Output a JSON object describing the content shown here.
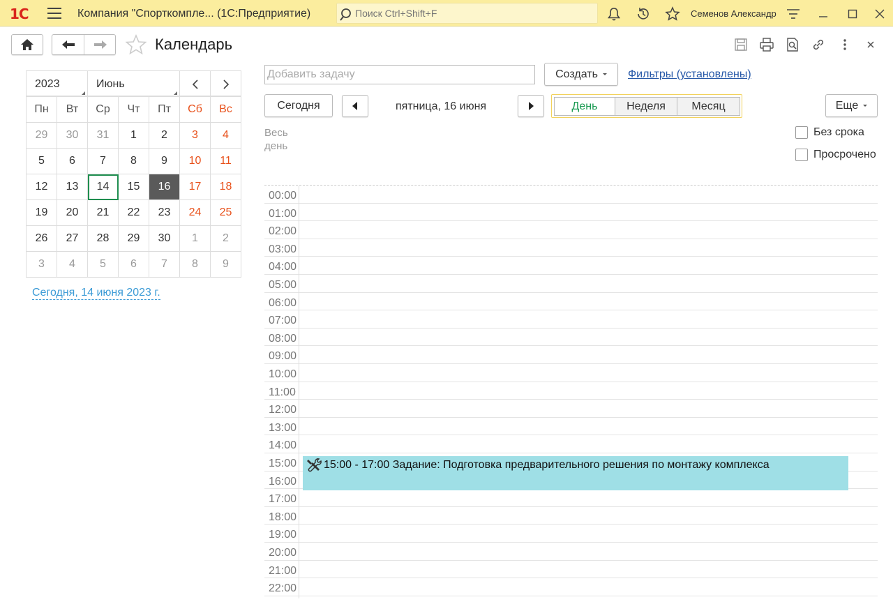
{
  "app": {
    "logo": "1С",
    "title": "Компания \"Спорткомпле...   (1С:Предприятие)",
    "search_placeholder": "Поиск Ctrl+Shift+F",
    "user": "Семенов Александр"
  },
  "form": {
    "title": "Календарь"
  },
  "mini_calendar": {
    "year": "2023",
    "month": "Июнь",
    "weekdays": [
      "Пн",
      "Вт",
      "Ср",
      "Чт",
      "Пт",
      "Сб",
      "Вс"
    ],
    "weeks": [
      [
        "29",
        "30",
        "31",
        "1",
        "2",
        "3",
        "4"
      ],
      [
        "5",
        "6",
        "7",
        "8",
        "9",
        "10",
        "11"
      ],
      [
        "12",
        "13",
        "14",
        "15",
        "16",
        "17",
        "18"
      ],
      [
        "19",
        "20",
        "21",
        "22",
        "23",
        "24",
        "25"
      ],
      [
        "26",
        "27",
        "28",
        "29",
        "30",
        "1",
        "2"
      ],
      [
        "3",
        "4",
        "5",
        "6",
        "7",
        "8",
        "9"
      ]
    ],
    "today_day": "14",
    "selected_day": "16",
    "today_link": "Сегодня, 14 июня 2023 г."
  },
  "toolbar": {
    "task_placeholder": "Добавить задачу",
    "create_label": "Создать",
    "filters_link": "Фильтры (установлены)",
    "today_label": "Сегодня",
    "current_date": "пятница, 16 июня",
    "view_day": "День",
    "view_week": "Неделя",
    "view_month": "Месяц",
    "more_label": "Еще"
  },
  "allday": {
    "label_line1": "Весь",
    "label_line2": "день",
    "no_deadline_label": "Без срока",
    "overdue_label": "Просрочено"
  },
  "hours": [
    "00:00",
    "01:00",
    "02:00",
    "03:00",
    "04:00",
    "05:00",
    "06:00",
    "07:00",
    "08:00",
    "09:00",
    "10:00",
    "11:00",
    "12:00",
    "13:00",
    "14:00",
    "15:00",
    "16:00",
    "17:00",
    "18:00",
    "19:00",
    "20:00",
    "21:00",
    "22:00"
  ],
  "event": {
    "text": "15:00 - 17:00 Задание: Подготовка предварительного решения по монтажу комплекса"
  },
  "colors": {
    "titlebar": "#fbed9e",
    "weekend": "#e8501a",
    "active_view": "#1a9a52",
    "event_bg": "#9fdfe6",
    "link": "#2658a8"
  }
}
